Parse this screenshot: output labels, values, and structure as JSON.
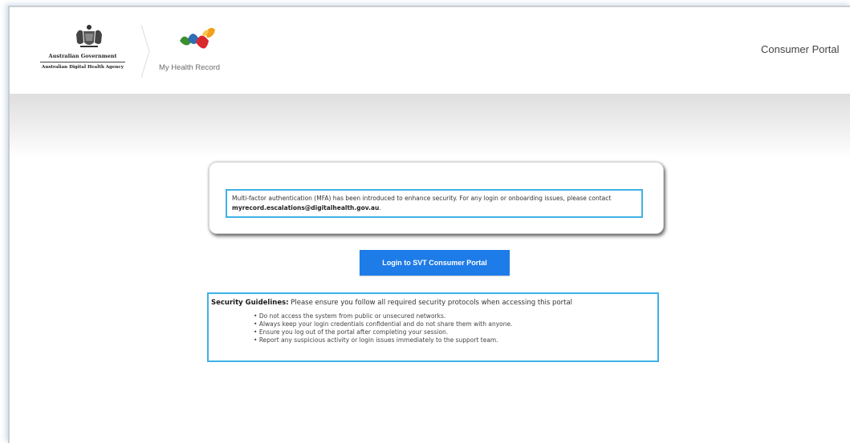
{
  "header": {
    "gov_name": "Australian Government",
    "agency_name": "Australian Digital Health Agency",
    "product_name": "My Health Record",
    "portal_title": "Consumer Portal"
  },
  "notice": {
    "text": "Multi-factor authentication (MFA) has been introduced to enhance security. For any login or onboarding issues, please contact ",
    "email": "myrecord.escalations@digitalhealth.gov.au",
    "end": "."
  },
  "login": {
    "label": "Login to SVT Consumer Portal"
  },
  "guidelines": {
    "title": "Security Guidelines:",
    "intro": " Please ensure you follow all required security protocols when accessing this portal",
    "items": [
      "Do not access the system from public or unsecured networks.",
      "Always keep your login credentials confidential and do not share them with anyone.",
      "Ensure you log out of the portal after completing your session.",
      "Report any suspicious activity or login issues immediately to the support team."
    ]
  },
  "colors": {
    "accent_button": "#1e7ce8",
    "highlight_border": "#3fb1e6",
    "logo_green": "#3b8f2e",
    "logo_blue": "#2f6db5",
    "logo_red": "#d8282e",
    "logo_orange": "#f2a01d"
  },
  "icons": [
    "australian-coat-of-arms",
    "my-health-record-logo"
  ]
}
